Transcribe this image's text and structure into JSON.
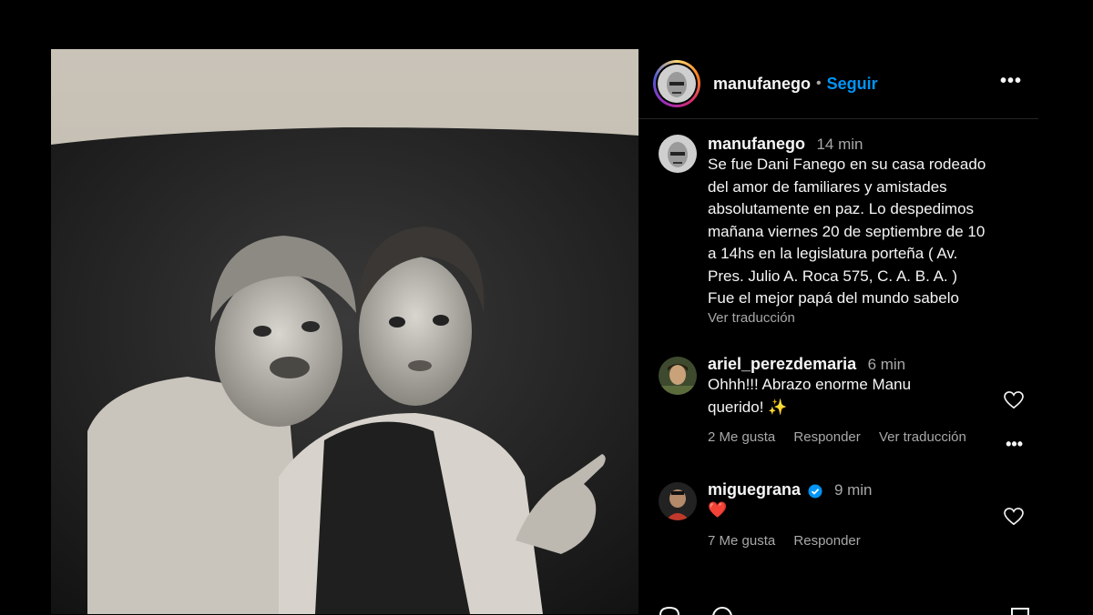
{
  "post": {
    "username": "manufanego",
    "separator": "•",
    "follow_label": "Seguir",
    "more_icon": "more-horizontal-icon"
  },
  "caption": {
    "username": "manufanego",
    "time": "14 min",
    "text": "Se fue Dani Fanego en su casa rodeado\ndel amor de familiares y amistades\nabsolutamente en paz. Lo despedimos\nmañana viernes 20 de septiembre de 10\na 14hs en la legislatura porteña ( Av.\nPres. Julio A. Roca 575, C. A. B. A. )\nFue el mejor papá del mundo sabelo",
    "translate": "Ver traducción"
  },
  "comments": [
    {
      "username": "ariel_perezdemaria",
      "time": "6 min",
      "text": "Ohhh!!! Abrazo enorme Manu\nquerido! ✨",
      "likes": "2 Me gusta",
      "reply": "Responder",
      "translate": "Ver traducción",
      "verified": false
    },
    {
      "username": "miguegrana",
      "time": "9 min",
      "text": "❤️",
      "likes": "7 Me gusta",
      "reply": "Responder",
      "verified": true
    }
  ],
  "colors": {
    "background": "#000000",
    "follow": "#0095f6",
    "muted": "#a8a8a8",
    "verified": "#0095f6",
    "heart": "#ed1c24"
  }
}
